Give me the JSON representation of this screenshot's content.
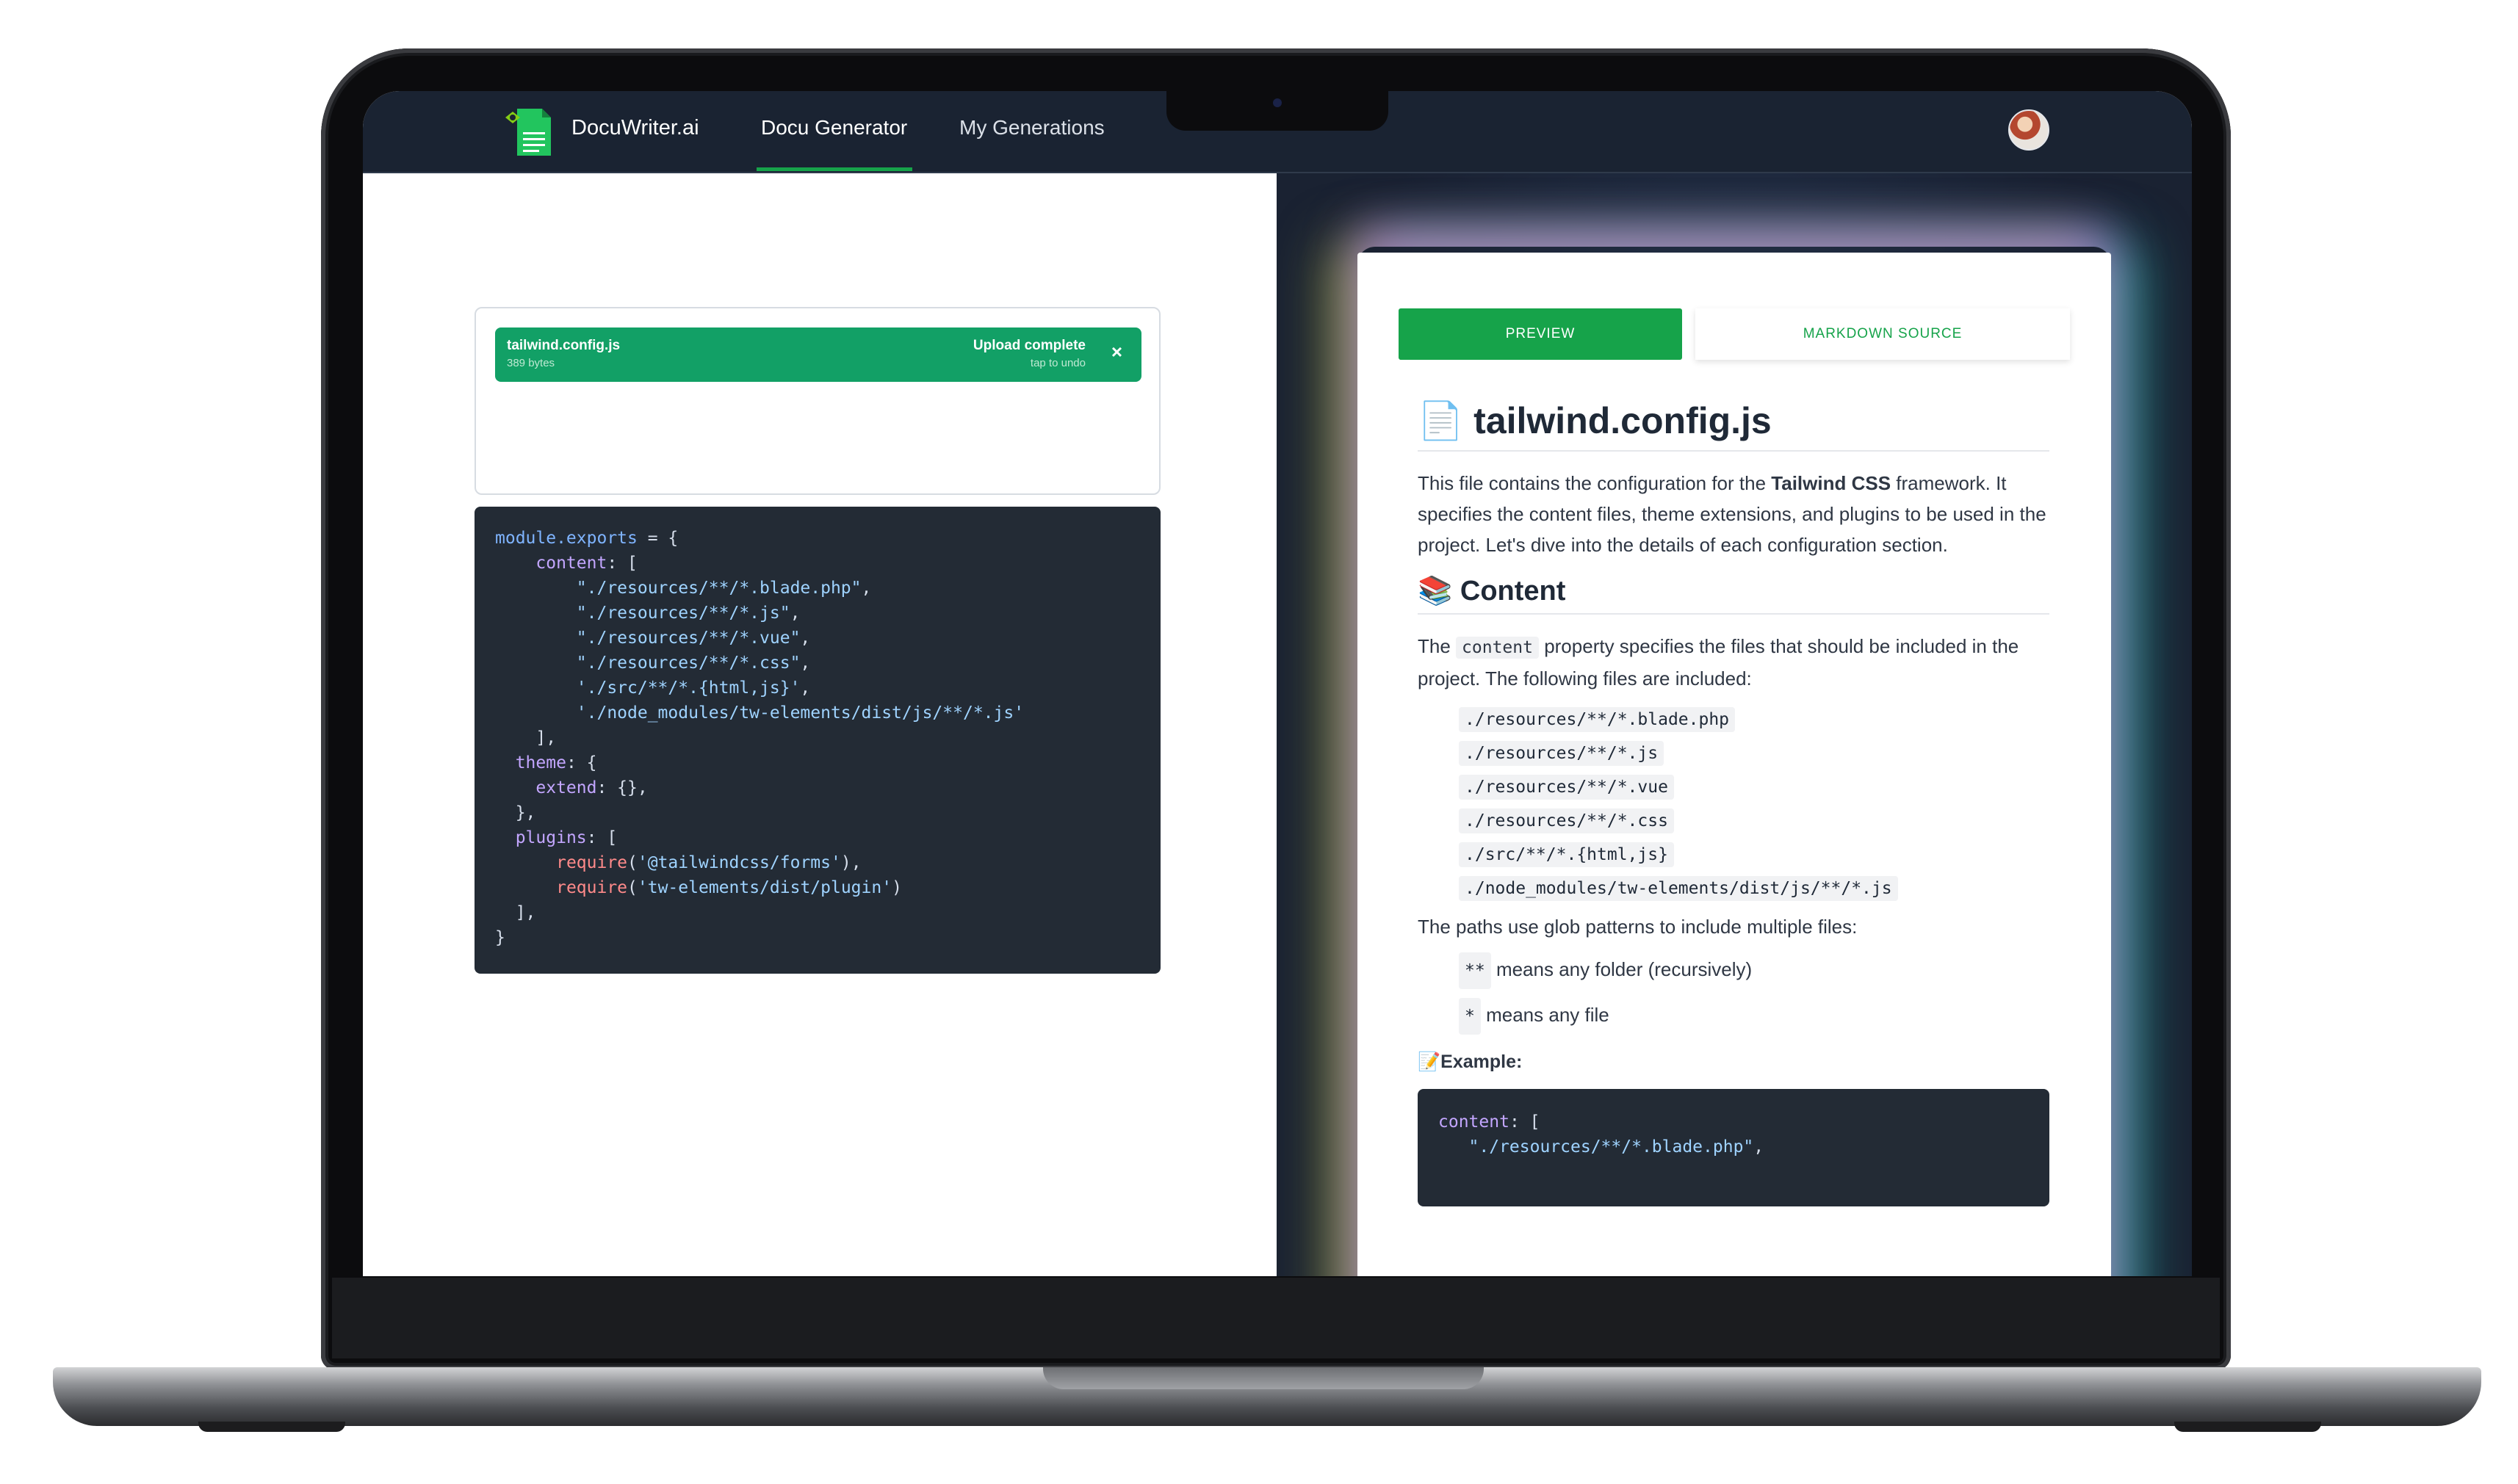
{
  "app": {
    "brand": "DocuWriter.ai",
    "nav": [
      "Docu Generator",
      "My Generations"
    ],
    "active_nav": "Docu Generator"
  },
  "upload": {
    "file_name": "tailwind.config.js",
    "file_size": "389 bytes",
    "status": "Upload complete",
    "undo_hint": "tap to undo",
    "close_glyph": "×"
  },
  "source_code_lines": [
    "module.exports = {",
    "    content: [",
    "        \"./resources/**/*.blade.php\",",
    "        \"./resources/**/*.js\",",
    "        \"./resources/**/*.vue\",",
    "        \"./resources/**/*.css\",",
    "        './src/**/*.{html,js}',",
    "        './node_modules/tw-elements/dist/js/**/*.js'",
    "    ],",
    "  theme: {",
    "    extend: {},",
    "  },",
    "  plugins: [",
    "      require('@tailwindcss/forms'),",
    "      require('tw-elements/dist/plugin')",
    "  ],",
    "}"
  ],
  "preview": {
    "tabs": {
      "preview": "PREVIEW",
      "source": "MARKDOWN SOURCE"
    },
    "title_emoji": "📄",
    "title": "tailwind.config.js",
    "intro_before": "This file contains the configuration for the ",
    "intro_bold": "Tailwind CSS",
    "intro_after": " framework. It specifies the content files, theme extensions, and plugins to be used in the project. Let's dive into the details of each configuration section.",
    "content_emoji": "📚",
    "content_heading": "Content",
    "content_p_before": "The ",
    "content_p_code": "content",
    "content_p_after": " property specifies the files that should be included in the project. The following files are included:",
    "files": [
      "./resources/**/*.blade.php",
      "./resources/**/*.js",
      "./resources/**/*.vue",
      "./resources/**/*.css",
      "./src/**/*.{html,js}",
      "./node_modules/tw-elements/dist/js/**/*.js"
    ],
    "glob_intro": "The paths use glob patterns to include multiple files:",
    "glob_items": [
      {
        "code": "**",
        "text": "means any folder (recursively)"
      },
      {
        "code": "*",
        "text": "means any file"
      }
    ],
    "example_emoji": "📝",
    "example_label": "Example:",
    "example_code_lines": [
      "content: [",
      "   \"./resources/**/*.blade.php\","
    ]
  },
  "colors": {
    "accent": "#16a34a",
    "upload_bar": "#12a066",
    "nav_bg": "#1a2332",
    "code_bg": "#232b35"
  }
}
